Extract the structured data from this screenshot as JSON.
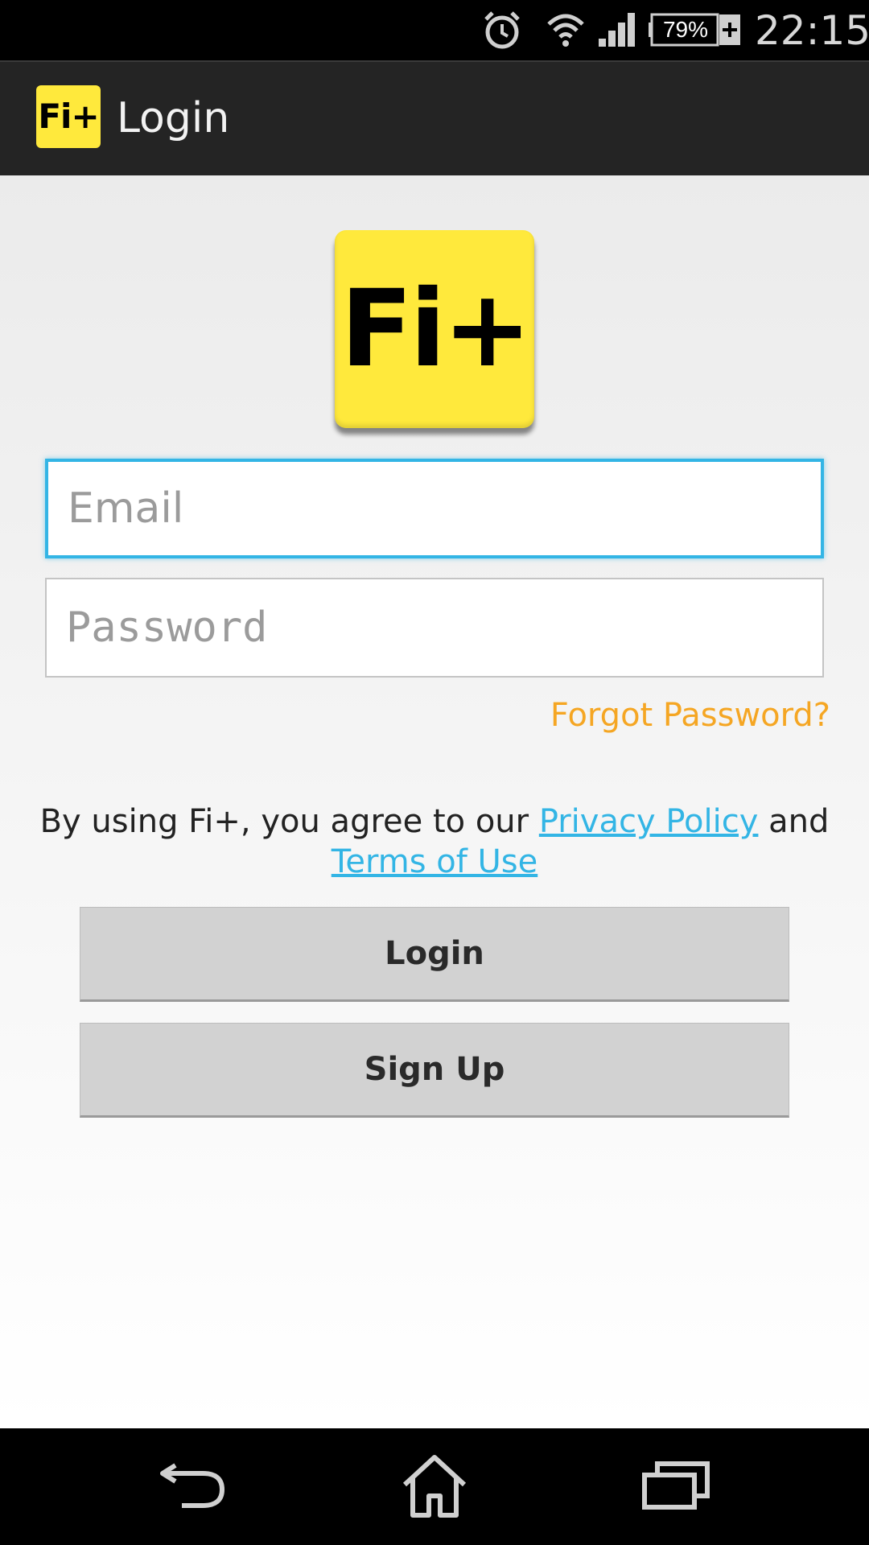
{
  "status_bar": {
    "battery": "79%",
    "time": "22:15",
    "icons": [
      "alarm-icon",
      "wifi-icon",
      "signal-icon",
      "battery-icon"
    ]
  },
  "action_bar": {
    "app_icon_text": "Fi+",
    "title": "Login"
  },
  "logo": {
    "text": "Fi+"
  },
  "form": {
    "email_placeholder": "Email",
    "password_placeholder": "Password",
    "forgot_password": "Forgot Password?"
  },
  "agreement": {
    "prefix": "By using Fi+, you agree to our ",
    "privacy_link": "Privacy Policy",
    "middle": " and",
    "terms_link": "Terms of Use"
  },
  "buttons": {
    "login": "Login",
    "signup": "Sign Up"
  },
  "nav_bar": {
    "icons": [
      "back-icon",
      "home-icon",
      "recents-icon"
    ]
  },
  "colors": {
    "accent": "#33b5e5",
    "brand_yellow": "#ffe93c",
    "link_orange": "#f5a623",
    "action_bar": "#242424"
  }
}
